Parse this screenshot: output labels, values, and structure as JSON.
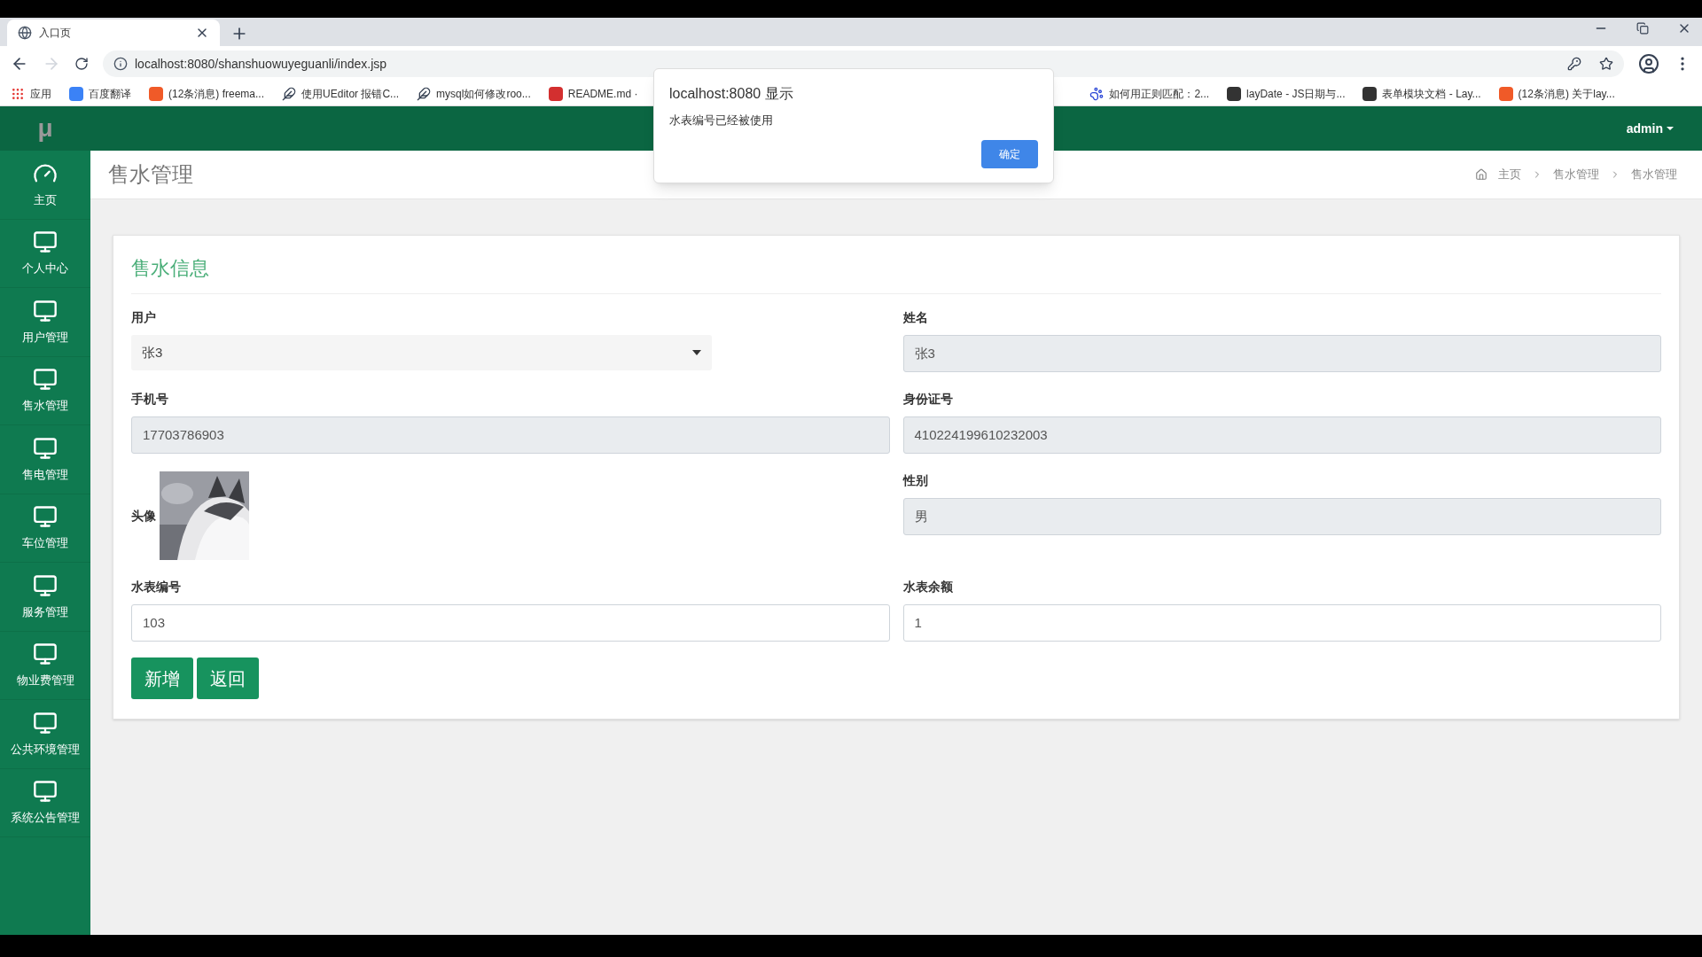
{
  "browser": {
    "tab": {
      "title": "入口页"
    },
    "address": "localhost:8080/shanshuowuyeguanli/index.jsp",
    "bookmarks": [
      {
        "label": "应用",
        "kind": "apps"
      },
      {
        "label": "百度翻译",
        "kind": "favicon",
        "color": "#3b82f6"
      },
      {
        "label": "(12条消息) freema...",
        "kind": "favicon",
        "color": "#f05a28"
      },
      {
        "label": "使用UEditor 报错C...",
        "kind": "glyph"
      },
      {
        "label": "mysql如何修改roo...",
        "kind": "glyph"
      },
      {
        "label": "README.md ·",
        "kind": "favicon",
        "color": "#d32f2f"
      },
      {
        "label": "如何用正则匹配：2...",
        "kind": "paw"
      },
      {
        "label": "layDate - JS日期与...",
        "kind": "favicon",
        "color": "#333333"
      },
      {
        "label": "表单模块文档 - Lay...",
        "kind": "favicon",
        "color": "#333333"
      },
      {
        "label": "(12条消息) 关于lay...",
        "kind": "favicon",
        "color": "#f05a28"
      }
    ]
  },
  "dialog": {
    "title": "localhost:8080 显示",
    "message": "水表编号已经被使用",
    "button": "确定"
  },
  "header": {
    "logo": "μ",
    "user": "admin"
  },
  "sidebar": {
    "items": [
      {
        "label": "主页",
        "kind": "dashboard"
      },
      {
        "label": "个人中心",
        "kind": "monitor"
      },
      {
        "label": "用户管理",
        "kind": "monitor"
      },
      {
        "label": "售水管理",
        "kind": "monitor"
      },
      {
        "label": "售电管理",
        "kind": "monitor"
      },
      {
        "label": "车位管理",
        "kind": "monitor"
      },
      {
        "label": "服务管理",
        "kind": "monitor"
      },
      {
        "label": "物业费管理",
        "kind": "monitor"
      },
      {
        "label": "公共环境管理",
        "kind": "monitor"
      },
      {
        "label": "系统公告管理",
        "kind": "monitor"
      }
    ]
  },
  "page": {
    "title": "售水管理",
    "breadcrumb": [
      "主页",
      "售水管理",
      "售水管理"
    ]
  },
  "form": {
    "title": "售水信息",
    "user": {
      "label": "用户",
      "value": "张3"
    },
    "name": {
      "label": "姓名",
      "value": "张3",
      "disabled": true
    },
    "phone": {
      "label": "手机号",
      "value": "17703786903",
      "disabled": true
    },
    "id_number": {
      "label": "身份证号",
      "value": "410224199610232003",
      "disabled": true
    },
    "avatar": {
      "label": "头像",
      "kind": "picture"
    },
    "gender": {
      "label": "性别",
      "value": "男",
      "disabled": true
    },
    "meter_number": {
      "label": "水表编号",
      "value": "103",
      "disabled": false
    },
    "meter_balance": {
      "label": "水表余额",
      "value": "1",
      "disabled": false
    },
    "buttons": [
      "新增",
      "返回"
    ]
  }
}
